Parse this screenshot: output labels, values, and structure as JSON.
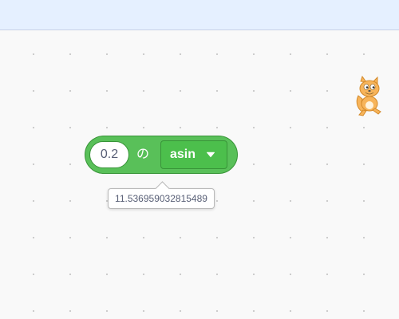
{
  "block": {
    "number_value": "0.2",
    "of_text": "の",
    "function_selected": "asin",
    "caret_icon": "caret-down-icon",
    "color": "#59c059"
  },
  "tooltip": {
    "text": "11.536959032815489"
  },
  "stage_sprite": {
    "icon": "scratch-cat-icon"
  }
}
